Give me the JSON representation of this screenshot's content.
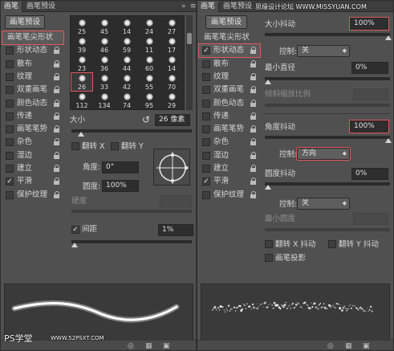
{
  "left_panel": {
    "tabs": [
      {
        "label": "画笔"
      },
      {
        "label": "画笔预设"
      }
    ],
    "preset_button": "画笔预设",
    "sidebar": [
      {
        "label": "画笔笔尖形状",
        "checkbox": false,
        "checked": false,
        "lock": false,
        "highlighted": true
      },
      {
        "label": "形状动态",
        "checkbox": true,
        "checked": false,
        "lock": true
      },
      {
        "label": "散布",
        "checkbox": true,
        "checked": false,
        "lock": true
      },
      {
        "label": "纹理",
        "checkbox": true,
        "checked": false,
        "lock": true
      },
      {
        "label": "双重画笔",
        "checkbox": true,
        "checked": false,
        "lock": true
      },
      {
        "label": "颜色动态",
        "checkbox": true,
        "checked": false,
        "lock": true
      },
      {
        "label": "传递",
        "checkbox": true,
        "checked": false,
        "lock": true
      },
      {
        "label": "画笔笔势",
        "checkbox": true,
        "checked": false,
        "lock": true
      },
      {
        "label": "杂色",
        "checkbox": true,
        "checked": false,
        "lock": true
      },
      {
        "label": "湿边",
        "checkbox": true,
        "checked": false,
        "lock": true
      },
      {
        "label": "建立",
        "checkbox": true,
        "checked": false,
        "lock": true
      },
      {
        "label": "平滑",
        "checkbox": true,
        "checked": true,
        "lock": true
      },
      {
        "label": "保护纹理",
        "checkbox": true,
        "checked": false,
        "lock": true
      }
    ],
    "brush_tips": [
      "25",
      "45",
      "14",
      "24",
      "27",
      "39",
      "46",
      "59",
      "11",
      "17",
      "23",
      "36",
      "44",
      "60",
      "14",
      "26",
      "33",
      "42",
      "55",
      "70",
      "112",
      "134",
      "74",
      "95",
      "29"
    ],
    "selected_tip": "26",
    "size_label": "大小",
    "size_value": "26 像素",
    "flip_x_label": "翻转 X",
    "flip_y_label": "翻转 Y",
    "angle_label": "角度:",
    "angle_value": "0°",
    "roundness_label": "圆度:",
    "roundness_value": "100%",
    "hardness_label": "硬度",
    "spacing_label": "间距",
    "spacing_checked": true,
    "spacing_value": "1%"
  },
  "right_panel": {
    "tabs": [
      {
        "label": "画笔"
      },
      {
        "label": "画笔预设"
      }
    ],
    "preset_button": "画笔预设",
    "sidebar": [
      {
        "label": "画笔笔尖形状",
        "checkbox": false,
        "checked": false,
        "lock": false,
        "highlighted": false
      },
      {
        "label": "形状动态",
        "checkbox": true,
        "checked": true,
        "lock": true,
        "highlighted": true
      },
      {
        "label": "散布",
        "checkbox": true,
        "checked": false,
        "lock": true
      },
      {
        "label": "纹理",
        "checkbox": true,
        "checked": false,
        "lock": true
      },
      {
        "label": "双重画笔",
        "checkbox": true,
        "checked": false,
        "lock": true
      },
      {
        "label": "颜色动态",
        "checkbox": true,
        "checked": false,
        "lock": true
      },
      {
        "label": "传递",
        "checkbox": true,
        "checked": false,
        "lock": true
      },
      {
        "label": "画笔笔势",
        "checkbox": true,
        "checked": false,
        "lock": true
      },
      {
        "label": "杂色",
        "checkbox": true,
        "checked": false,
        "lock": true
      },
      {
        "label": "湿边",
        "checkbox": true,
        "checked": false,
        "lock": true
      },
      {
        "label": "建立",
        "checkbox": true,
        "checked": false,
        "lock": true
      },
      {
        "label": "平滑",
        "checkbox": true,
        "checked": true,
        "lock": true
      },
      {
        "label": "保护纹理",
        "checkbox": true,
        "checked": false,
        "lock": true
      }
    ],
    "size_jitter_label": "大小抖动",
    "size_jitter_value": "100%",
    "control_label": "控制:",
    "control1_value": "关",
    "min_diameter_label": "最小直径",
    "min_diameter_value": "0%",
    "tilt_scale_label": "倾斜缩放比例",
    "angle_jitter_label": "角度抖动",
    "angle_jitter_value": "100%",
    "control2_value": "方向",
    "roundness_jitter_label": "圆度抖动",
    "roundness_jitter_value": "0%",
    "control3_value": "关",
    "min_roundness_label": "最小圆度",
    "flip_x_jitter_label": "翻转 X 抖动",
    "flip_y_jitter_label": "翻转 Y 抖动",
    "brush_projection_label": "画笔投影"
  },
  "watermarks": {
    "top_right": "思缘设计论坛 WWW.MISSYUAN.COM",
    "bottom_left": "PS学堂",
    "bottom_url": "WWW.52PSXT.COM"
  },
  "accent_color": "#e2585d"
}
